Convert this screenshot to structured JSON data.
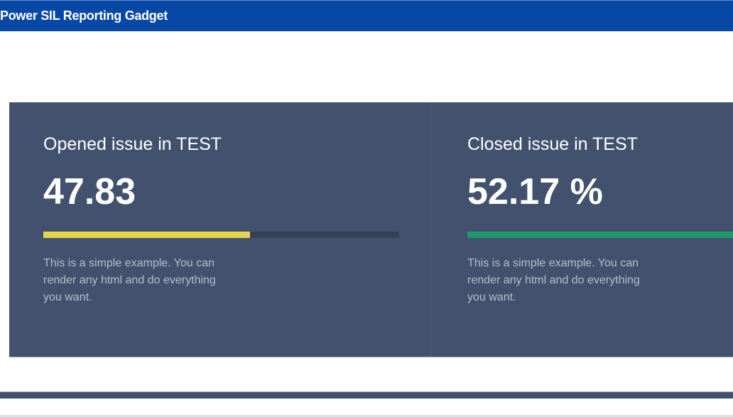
{
  "header": {
    "title": "Power SIL Reporting Gadget"
  },
  "cards": [
    {
      "title": "Opened issue in TEST",
      "value": "47.83",
      "progress": 0.58,
      "bar_color": "#e6d44c",
      "description": "This is a simple example. You can render any html and do everything you want."
    },
    {
      "title": "Closed issue in TEST",
      "value": "52.17 %",
      "progress": 1.0,
      "bar_color": "#1f9a6a",
      "description": "This is a simple example. You can render any html and do everything you want."
    }
  ]
}
